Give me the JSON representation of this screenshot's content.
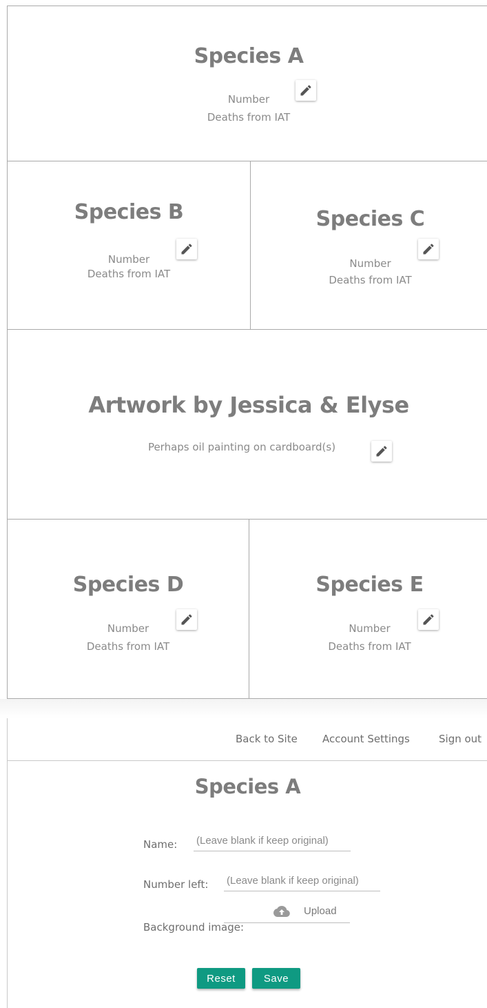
{
  "grid": {
    "species_a": {
      "title": "Species A",
      "number_label": "Number",
      "deaths_label": "Deaths from IAT"
    },
    "species_b": {
      "title": "Species B",
      "number_label": "Number",
      "deaths_label": "Deaths from IAT"
    },
    "species_c": {
      "title": "Species C",
      "number_label": "Number",
      "deaths_label": "Deaths from IAT"
    },
    "artwork": {
      "title": "Artwork by Jessica & Elyse",
      "subtitle": "Perhaps oil painting on cardboard(s)"
    },
    "species_d": {
      "title": "Species D",
      "number_label": "Number",
      "deaths_label": "Deaths from IAT"
    },
    "species_e": {
      "title": "Species E",
      "number_label": "Number",
      "deaths_label": "Deaths from IAT"
    },
    "edit_icon": "pencil-icon"
  },
  "nav": {
    "back_to_site": "Back to Site",
    "account_settings": "Account Settings",
    "sign_out": "Sign out"
  },
  "form": {
    "title": "Species A",
    "name_label": "Name:",
    "name_placeholder": "(Leave blank if keep original)",
    "number_left_label": "Number left:",
    "number_left_placeholder": "(Leave blank if keep original)",
    "background_image_label": "Background image:",
    "upload_label": "Upload",
    "upload_icon": "cloud-upload-icon",
    "reset_label": "Reset",
    "save_label": "Save"
  },
  "colors": {
    "accent": "#0f9a82",
    "text": "#7a7a7a",
    "border": "#a9a9a9"
  }
}
